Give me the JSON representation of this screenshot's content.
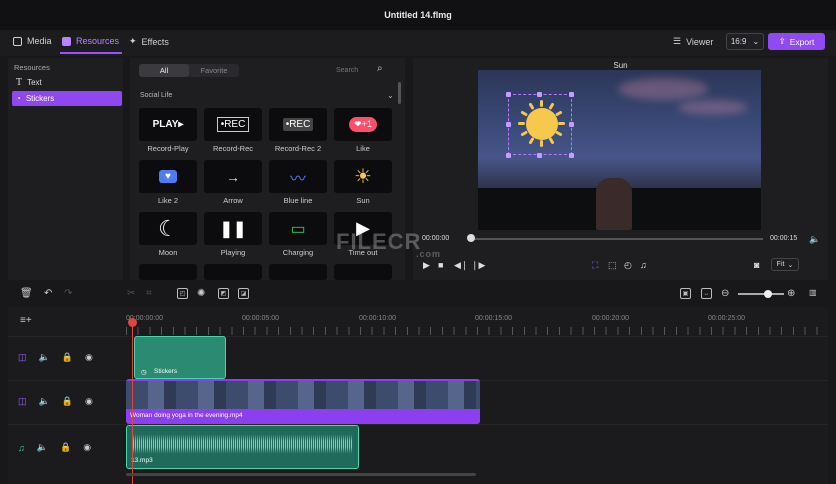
{
  "window": {
    "title": "Untitled 14.flmg"
  },
  "topbar": {
    "tabs": [
      {
        "label": "Media"
      },
      {
        "label": "Resources"
      },
      {
        "label": "Effects"
      }
    ],
    "viewer_label": "Viewer",
    "ratio": "16:9",
    "export_label": "Export"
  },
  "sidebar": {
    "heading": "Resources",
    "items": [
      {
        "label": "Text"
      },
      {
        "label": "Stickers"
      }
    ]
  },
  "resources": {
    "filters": [
      "All",
      "Favorite"
    ],
    "search_placeholder": "Search",
    "category": "Social Life",
    "stickers": [
      {
        "label": "Record-Play",
        "glyph": "PLAY▸"
      },
      {
        "label": "Record-Rec",
        "glyph": "•REC"
      },
      {
        "label": "Record-Rec 2",
        "glyph": "•REC"
      },
      {
        "label": "Like",
        "glyph": "❤+1"
      },
      {
        "label": "Like 2",
        "glyph": "♥"
      },
      {
        "label": "Arrow",
        "glyph": "→"
      },
      {
        "label": "Blue line",
        "glyph": "〰"
      },
      {
        "label": "Sun",
        "glyph": "☀"
      },
      {
        "label": "Moon",
        "glyph": "☾"
      },
      {
        "label": "Playing",
        "glyph": "❚❚"
      },
      {
        "label": "Charging",
        "glyph": "▭"
      },
      {
        "label": "Time out",
        "glyph": "▶"
      }
    ]
  },
  "preview": {
    "title": "Sun",
    "time_current": "00:00:00",
    "time_total": "00:00:15",
    "fit_label": "Fit"
  },
  "timeline": {
    "ruler": [
      "00:00:00:00",
      "00:00:05:00",
      "00:00:10:00",
      "00:00:15:00",
      "00:00:20:00",
      "00:00:25:00"
    ],
    "clips": {
      "sticker": "Stickers",
      "video": "Woman doing yoga in the evening.mp4",
      "audio": "13.mp3"
    }
  },
  "watermark": {
    "main": "FILECR",
    "sub": ".com"
  },
  "colors": {
    "accent": "#8f48ef",
    "clip_green": "#2a8a72",
    "playhead": "#e04545"
  }
}
